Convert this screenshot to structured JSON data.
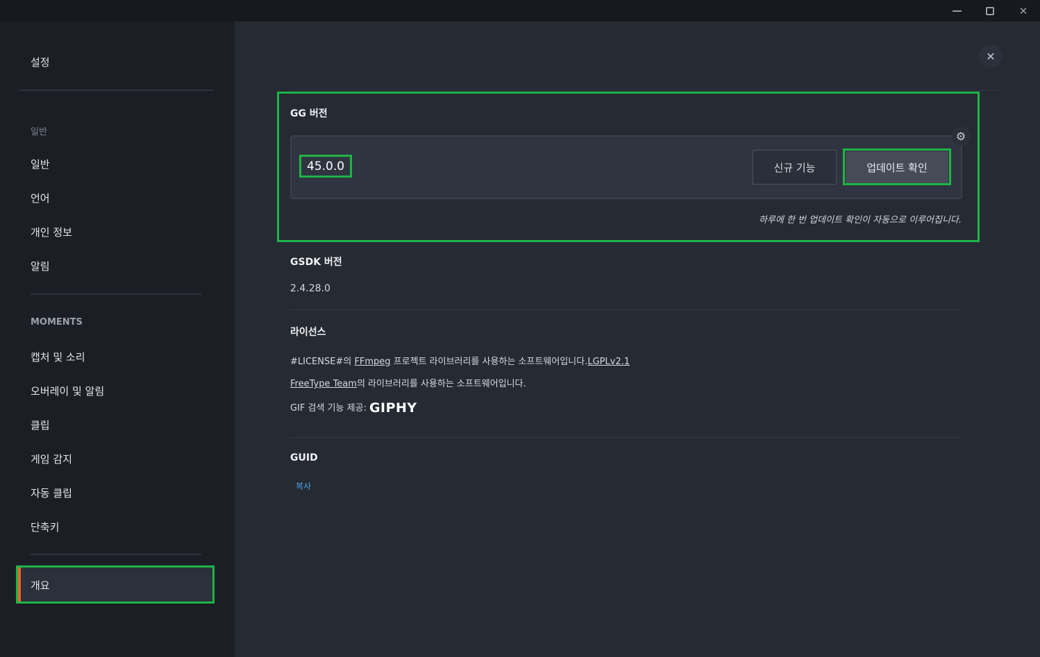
{
  "window": {
    "minimize_icon": "minimize-icon",
    "maximize_icon": "maximize-icon",
    "close_icon": "close-icon"
  },
  "sidebar": {
    "title": "설정",
    "section_general": "일반",
    "general_items": [
      "일반",
      "언어",
      "개인 정보",
      "알림"
    ],
    "section_moments": "MOMENTS",
    "moments_items": [
      "캡처 및 소리",
      "오버레이 및 알림",
      "클립",
      "게임 감지",
      "자동 클립",
      "단축키"
    ],
    "active_item": "개요",
    "accent_color": "#e8632b"
  },
  "main": {
    "close_symbol": "✕",
    "gg_version": {
      "title": "GG 버전",
      "version": "45.0.0",
      "new_features_label": "신규 기능",
      "check_update_label": "업데이트 확인",
      "gear_symbol": "⚙",
      "auto_note": "하루에 한 번 업데이트 확인이 자동으로 이루어집니다."
    },
    "gsdk": {
      "title": "GSDK 버전",
      "version": "2.4.28.0"
    },
    "license": {
      "title": "라이선스",
      "line1_prefix": "#LICENSE#의 ",
      "line1_link": "FFmpeg",
      "line1_middle": " 프로젝트 라이브러리를 사용하는 소프트웨어입니다.",
      "line1_license_link": "LGPLv2.1",
      "line2_link": "FreeType Team",
      "line2_suffix": "의 라이브러리를 사용하는 소프트웨어입니다.",
      "line3_prefix": "GIF 검색 기능 제공:",
      "giphy_logo": "GIPHY"
    },
    "guid": {
      "title": "GUID",
      "copy_label": "복사"
    }
  },
  "highlight_color": "#1fb446"
}
